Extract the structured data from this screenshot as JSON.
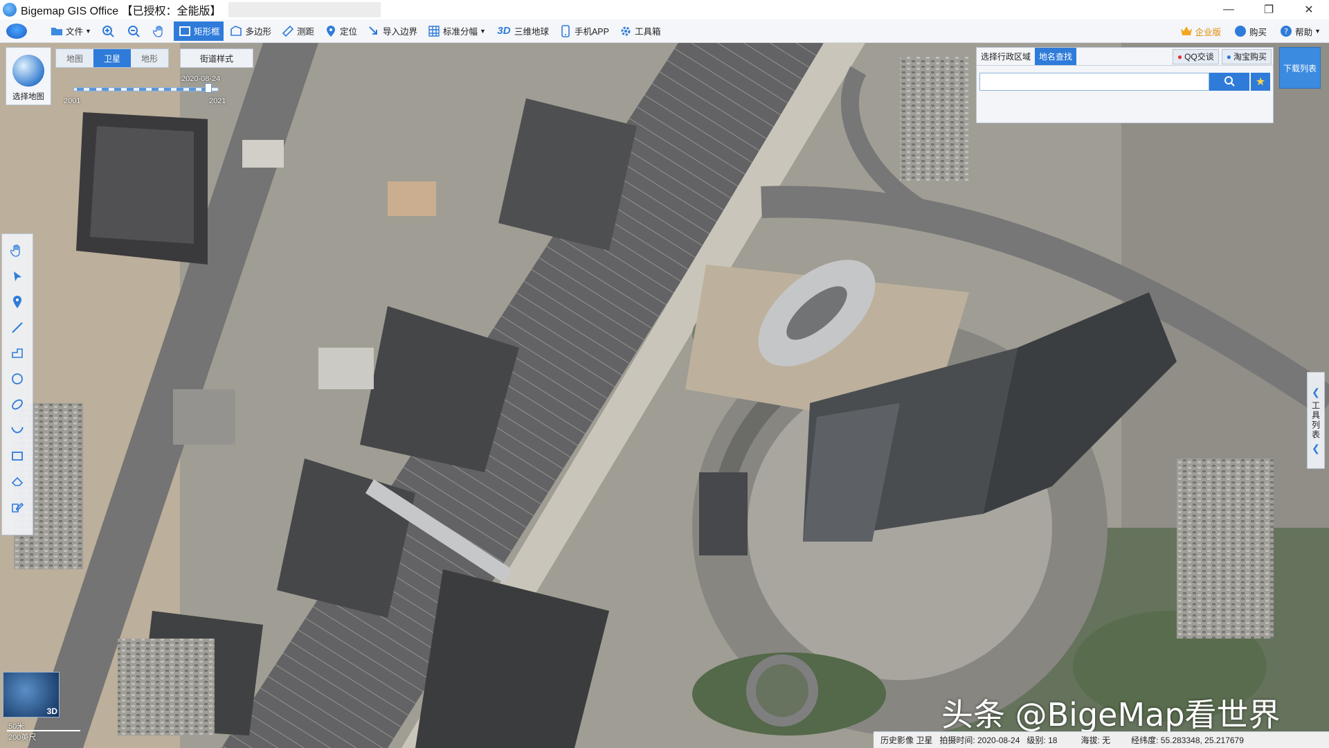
{
  "window": {
    "title": "Bigemap GIS Office 【已授权：全能版】",
    "controls": [
      "—",
      "❐",
      "✕"
    ]
  },
  "toolbar": {
    "items": [
      {
        "id": "file",
        "label": "文件",
        "icon": "folder-icon",
        "dropdown": true
      },
      {
        "id": "zoom-in",
        "label": "",
        "icon": "zoom-in-icon"
      },
      {
        "id": "zoom-out",
        "label": "",
        "icon": "zoom-out-icon"
      },
      {
        "id": "pan",
        "label": "",
        "icon": "hand-icon"
      },
      {
        "id": "rectangle",
        "label": "矩形框",
        "icon": "rectangle-select-icon",
        "active": true
      },
      {
        "id": "polygon",
        "label": "多边形",
        "icon": "polygon-icon"
      },
      {
        "id": "measure",
        "label": "测距",
        "icon": "ruler-icon"
      },
      {
        "id": "locate",
        "label": "定位",
        "icon": "location-pin-icon"
      },
      {
        "id": "import-boundary",
        "label": "导入边界",
        "icon": "import-icon"
      },
      {
        "id": "standard-tiles",
        "label": "标准分幅",
        "icon": "grid-icon",
        "dropdown": true
      },
      {
        "id": "globe3d",
        "label": "三维地球",
        "icon": "3d-icon"
      },
      {
        "id": "mobile-app",
        "label": "手机APP",
        "icon": "phone-icon"
      },
      {
        "id": "toolbox",
        "label": "工具箱",
        "icon": "gear-icon"
      }
    ],
    "right": [
      {
        "id": "enterprise",
        "label": "企业版",
        "icon": "crown-icon"
      },
      {
        "id": "buy",
        "label": "购买",
        "icon": "buy-icon"
      },
      {
        "id": "help",
        "label": "帮助",
        "icon": "help-icon",
        "dropdown": true
      }
    ],
    "accent": "#2f7bd9"
  },
  "map_panel": {
    "select_map_label": "选择地图",
    "type_tabs": [
      {
        "label": "地图",
        "active": false
      },
      {
        "label": "卫星",
        "active": true
      },
      {
        "label": "地形",
        "active": false
      }
    ],
    "street_style": "街道样式",
    "time_slider": {
      "current_date": "2020-08-24",
      "start_label": "2001",
      "end_label": "2021",
      "position_fraction": 0.95
    }
  },
  "search_panel": {
    "tabs": [
      {
        "label": "选择行政区域",
        "active": false
      },
      {
        "label": "地名查找",
        "active": true
      }
    ],
    "qq_label": "QQ交谈",
    "taobao_label": "淘宝购买",
    "input_value": "",
    "input_placeholder": ""
  },
  "download_list_label": "下载列表",
  "right_tab": {
    "label": "工具列表"
  },
  "left_tools": [
    "hand-icon",
    "pointer-icon",
    "pin-icon",
    "line-icon",
    "polyline-icon",
    "circle-icon",
    "ellipse-icon",
    "curve-icon",
    "rectangle-icon",
    "eraser-icon",
    "edit-icon"
  ],
  "minimap": {
    "label": "3D"
  },
  "scalebar": {
    "metric": "50米",
    "imperial": "200英尺"
  },
  "watermark": "头条 @BigeMap看世界",
  "statusbar": {
    "source": "历史影像 卫星",
    "capture_time": "拍摄时间: 2020-08-24",
    "level": "级别:  18",
    "altitude": "海拔: 无",
    "coords": "经纬度:  55.283348, 25.217679"
  }
}
